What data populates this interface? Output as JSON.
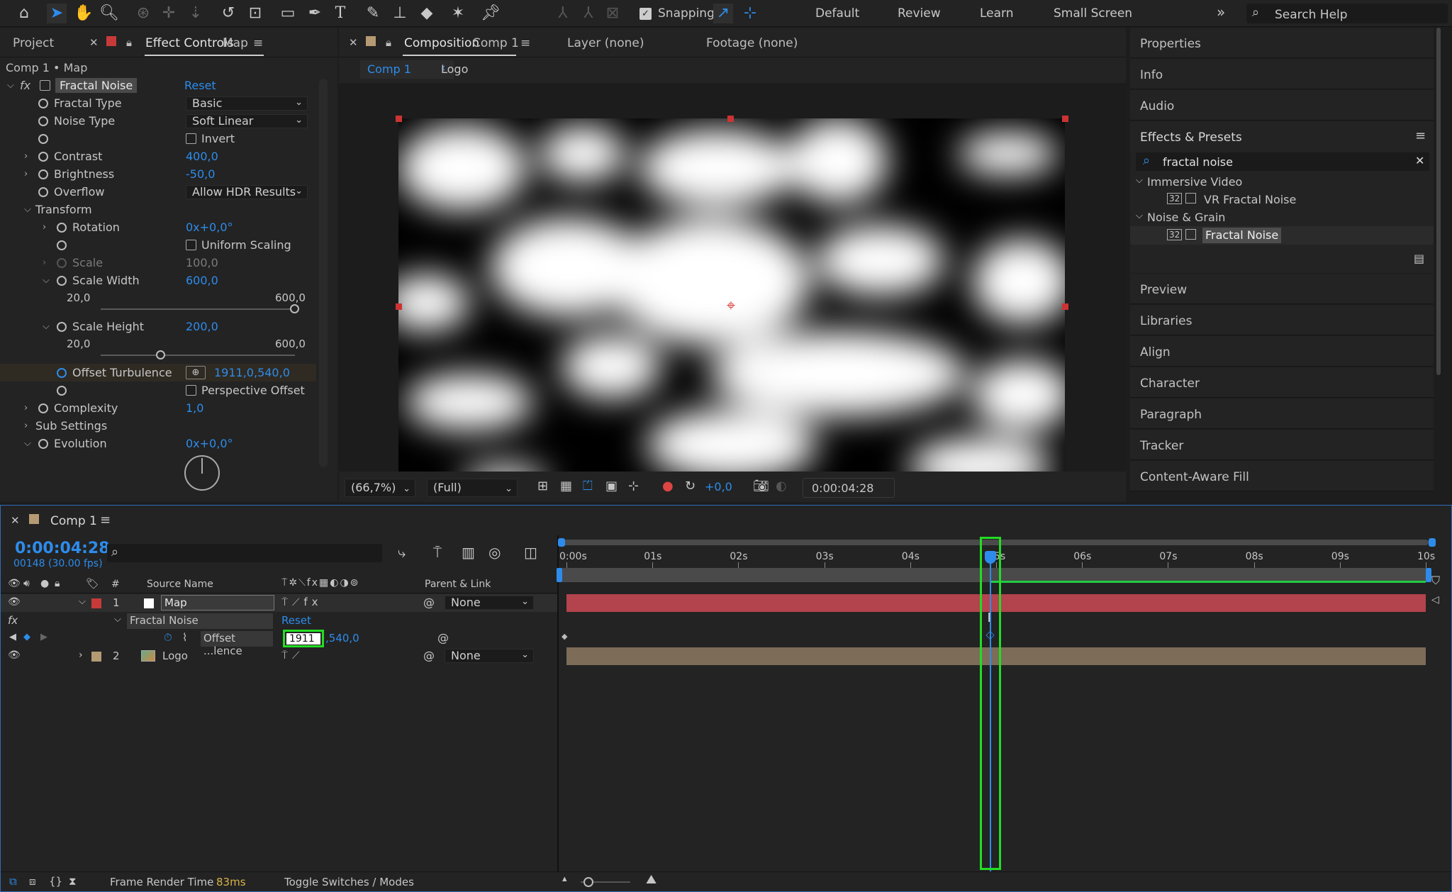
{
  "toolbar": {
    "snapping_label": "Snapping",
    "workspaces": [
      "Default",
      "Review",
      "Learn",
      "Small Screen"
    ],
    "more_icon": "»",
    "search_placeholder": "Search Help"
  },
  "project_tab": "Project",
  "effect_controls": {
    "tab_label": "Effect Controls",
    "tab_layer": "Map",
    "breadcrumb": "Comp 1 • Map",
    "effect_name": "Fractal Noise",
    "reset": "Reset",
    "props": {
      "fractal_type_label": "Fractal Type",
      "fractal_type_value": "Basic",
      "noise_type_label": "Noise Type",
      "noise_type_value": "Soft Linear",
      "invert_label": "Invert",
      "contrast_label": "Contrast",
      "contrast_value": "400,0",
      "brightness_label": "Brightness",
      "brightness_value": "-50,0",
      "overflow_label": "Overflow",
      "overflow_value": "Allow HDR Results",
      "transform_label": "Transform",
      "rotation_label": "Rotation",
      "rotation_value": "0x+0,0°",
      "uniform_label": "Uniform Scaling",
      "scale_label": "Scale",
      "scale_value": "100,0",
      "scale_width_label": "Scale Width",
      "scale_width_value": "600,0",
      "sw_min": "20,0",
      "sw_max": "600,0",
      "scale_height_label": "Scale Height",
      "scale_height_value": "200,0",
      "sh_min": "20,0",
      "sh_max": "600,0",
      "offset_label": "Offset Turbulence",
      "offset_value": "1911,0,540,0",
      "perspective_label": "Perspective Offset",
      "complexity_label": "Complexity",
      "complexity_value": "1,0",
      "sub_settings_label": "Sub Settings",
      "evolution_label": "Evolution",
      "evolution_value": "0x+0,0°"
    },
    "scale_width_level": 1.0,
    "scale_height_level": 0.31
  },
  "composition": {
    "tab_label": "Composition",
    "tab_comp": "Comp 1",
    "layer_tab": "Layer (none)",
    "footage_tab": "Footage (none)",
    "breadcrumb_active": "Comp 1",
    "breadcrumb_next": "Logo",
    "zoom": "(66,7%)",
    "resolution": "(Full)",
    "exposure": "+0,0",
    "timecode": "0:00:04:28"
  },
  "right_panel": {
    "top_items": [
      "Properties",
      "Info",
      "Audio"
    ],
    "effects_title": "Effects & Presets",
    "search_value": "fractal noise",
    "groups": [
      {
        "name": "Immersive Video",
        "item": "VR Fractal Noise"
      },
      {
        "name": "Noise & Grain",
        "item": "Fractal Noise"
      }
    ],
    "bottom_items": [
      "Preview",
      "Libraries",
      "Align",
      "Character",
      "Paragraph",
      "Tracker",
      "Content-Aware Fill"
    ]
  },
  "timeline": {
    "tab_label": "Comp 1",
    "timecode": "0:00:04:28",
    "frame_info": "00148 (30.00 fps)",
    "col_hash": "#",
    "col_source": "Source Name",
    "col_parent": "Parent & Link",
    "layers": [
      {
        "num": "1",
        "name": "Map",
        "parent": "None",
        "color": "#c73a3a"
      },
      {
        "num": "2",
        "name": "Logo",
        "parent": "None",
        "color": "#b59a73"
      }
    ],
    "effect_name": "Fractal Noise",
    "effect_reset": "Reset",
    "prop_name": "Offset ...lence",
    "prop_edit_value": "1911",
    "prop_rest_value": ",540,0",
    "ruler": [
      "0:00s",
      "01s",
      "02s",
      "03s",
      "04s",
      "05s",
      "06s",
      "07s",
      "08s",
      "09s",
      "10s"
    ],
    "playhead_seconds": 4.93,
    "duration_seconds": 10
  },
  "status": {
    "render_label": "Frame Render Time",
    "render_value": "83ms",
    "toggle_label": "Toggle Switches / Modes"
  },
  "colors": {
    "accent": "#2d8ceb",
    "highlight": "#22dd22",
    "layer_map_bar": "#b3434d",
    "layer_logo_bar": "#7d6c57"
  }
}
